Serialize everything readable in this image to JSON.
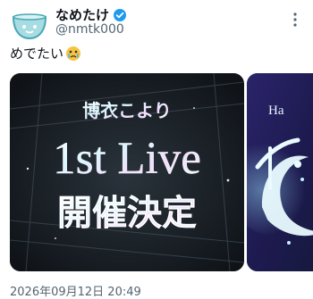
{
  "post": {
    "author": {
      "display_name": "なめたけ",
      "handle": "@nmtk000",
      "verified": true,
      "avatar_icon": "bowl-face-avatar"
    },
    "text": "めでたい",
    "emoji": "crying-face-emoji",
    "timestamp": "2026年09月12日 20:49"
  },
  "media": [
    {
      "title_line1": "博衣こより",
      "title_line2": "1st Live",
      "title_line3": "開催決定"
    },
    {
      "partial_text": "Ha"
    }
  ],
  "colors": {
    "verified": "#1d9bf0",
    "text": "#0f1419",
    "secondary_text": "#536471",
    "media1_bg": "#171d24",
    "media2_bg": "#24214f",
    "avatar_accent": "#9fd8de"
  }
}
